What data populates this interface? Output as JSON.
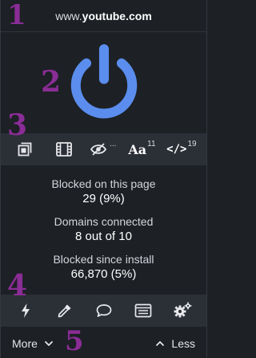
{
  "header": {
    "hostname_prefix": "www.",
    "hostname_domain": "youtube.com"
  },
  "colors": {
    "accent": "#5a8ded",
    "background": "#1d2025",
    "toolbar_bg": "#2b2f36",
    "marker": "#8a2d96"
  },
  "power_button": {
    "icon": "power-icon",
    "state": "on"
  },
  "quick_tools": [
    {
      "icon": "element-picker-icon"
    },
    {
      "icon": "media-filmstrip-icon"
    },
    {
      "icon": "eye-slash-icon",
      "badge": "..."
    },
    {
      "icon": "font-icon",
      "label": "Aa",
      "badge": "11"
    },
    {
      "icon": "code-icon",
      "label": "</>",
      "badge": "19"
    }
  ],
  "stats": {
    "blocked_page_label": "Blocked on this page",
    "blocked_page_value": "29 (9%)",
    "domains_label": "Domains connected",
    "domains_value": "8 out of 10",
    "blocked_install_label": "Blocked since install",
    "blocked_install_value": "66,870 (5%)"
  },
  "bottom_tools": [
    {
      "icon": "lightning-icon"
    },
    {
      "icon": "eyedropper-icon"
    },
    {
      "icon": "speech-bubble-icon"
    },
    {
      "icon": "list-icon"
    },
    {
      "icon": "gears-icon"
    }
  ],
  "footer": {
    "more_label": "More",
    "less_label": "Less"
  },
  "markers": [
    "1",
    "2",
    "3",
    "4",
    "5"
  ]
}
